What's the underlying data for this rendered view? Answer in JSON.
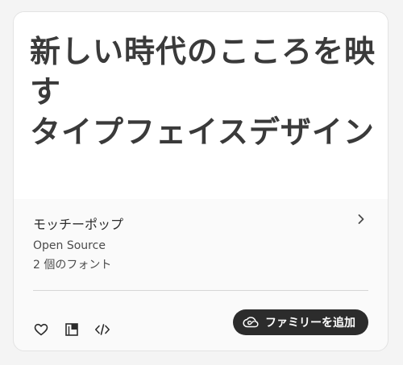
{
  "card": {
    "sample_line1": "新しい時代のこころを映す",
    "sample_line2": "タイプフェイスデザイン",
    "family_name": "モッチーポップ",
    "foundry": "Open Source",
    "font_count": "2 個のフォント",
    "add_button_label": "ファミリーを追加"
  },
  "icons": {
    "chevron": "chevron-right-icon",
    "favorite": "heart-icon",
    "compare": "compare-panel-icon",
    "embed": "code-icon",
    "creative_cloud": "creative-cloud-icon"
  },
  "colors": {
    "page_background": "#f4f4f4",
    "card_background": "#fafafa",
    "preview_background": "#ffffff",
    "button_background": "#2c2c2c",
    "button_text": "#ffffff",
    "text": "#2c2c2c"
  }
}
